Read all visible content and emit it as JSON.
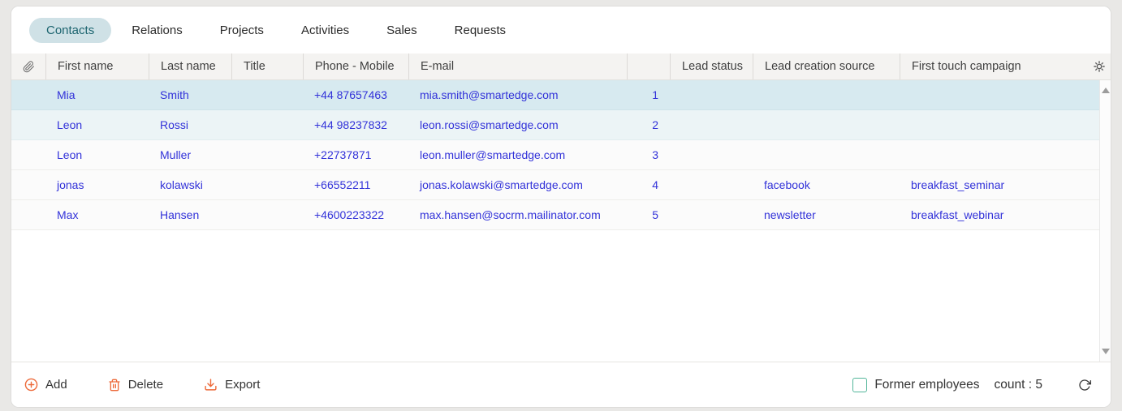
{
  "tabs": {
    "items": [
      {
        "label": "Contacts",
        "active": true
      },
      {
        "label": "Relations",
        "active": false
      },
      {
        "label": "Projects",
        "active": false
      },
      {
        "label": "Activities",
        "active": false
      },
      {
        "label": "Sales",
        "active": false
      },
      {
        "label": "Requests",
        "active": false
      }
    ]
  },
  "table": {
    "columns": {
      "attach": "",
      "first_name": "First name",
      "last_name": "Last name",
      "title": "Title",
      "phone": "Phone - Mobile",
      "email": "E-mail",
      "index": "",
      "lead_status": "Lead status",
      "lead_source": "Lead creation source",
      "campaign": "First touch campaign"
    },
    "rows": [
      {
        "first_name": "Mia",
        "last_name": "Smith",
        "title": "",
        "phone": "+44 87657463",
        "email": "mia.smith@smartedge.com",
        "index": "1",
        "lead_status": "",
        "lead_source": "",
        "campaign": ""
      },
      {
        "first_name": "Leon",
        "last_name": "Rossi",
        "title": "",
        "phone": "+44 98237832",
        "email": "leon.rossi@smartedge.com",
        "index": "2",
        "lead_status": "",
        "lead_source": "",
        "campaign": ""
      },
      {
        "first_name": "Leon",
        "last_name": "Muller",
        "title": "",
        "phone": "+22737871",
        "email": "leon.muller@smartedge.com",
        "index": "3",
        "lead_status": "",
        "lead_source": "",
        "campaign": ""
      },
      {
        "first_name": "jonas",
        "last_name": "kolawski",
        "title": "",
        "phone": "+66552211",
        "email": "jonas.kolawski@smartedge.com",
        "index": "4",
        "lead_status": "",
        "lead_source": "facebook",
        "campaign": "breakfast_seminar"
      },
      {
        "first_name": "Max",
        "last_name": "Hansen",
        "title": "",
        "phone": "+4600223322",
        "email": "max.hansen@socrm.mailinator.com",
        "index": "5",
        "lead_status": "",
        "lead_source": "newsletter",
        "campaign": "breakfast_webinar"
      }
    ]
  },
  "toolbar": {
    "add": "Add",
    "delete": "Delete",
    "export": "Export",
    "former_employees": "Former employees",
    "count": "count : 5"
  },
  "icons": {
    "attach": "paperclip",
    "settings": "gear",
    "add": "plus-circle",
    "delete": "trash",
    "export": "download-arrow",
    "refresh": "circular-arrow",
    "scroll_up": "triangle-up",
    "scroll_down": "triangle-down"
  },
  "colors": {
    "accent_orange": "#ed6a3a",
    "record_text_blue": "#3232d9",
    "active_tab_bg": "#cfe1e6",
    "active_tab_text": "#1d6570",
    "selected_row_bg": "#d7eaf0",
    "second_row_bg": "#ecf4f6",
    "checkbox_border": "#53b69a",
    "header_bg": "#f4f3f1"
  }
}
